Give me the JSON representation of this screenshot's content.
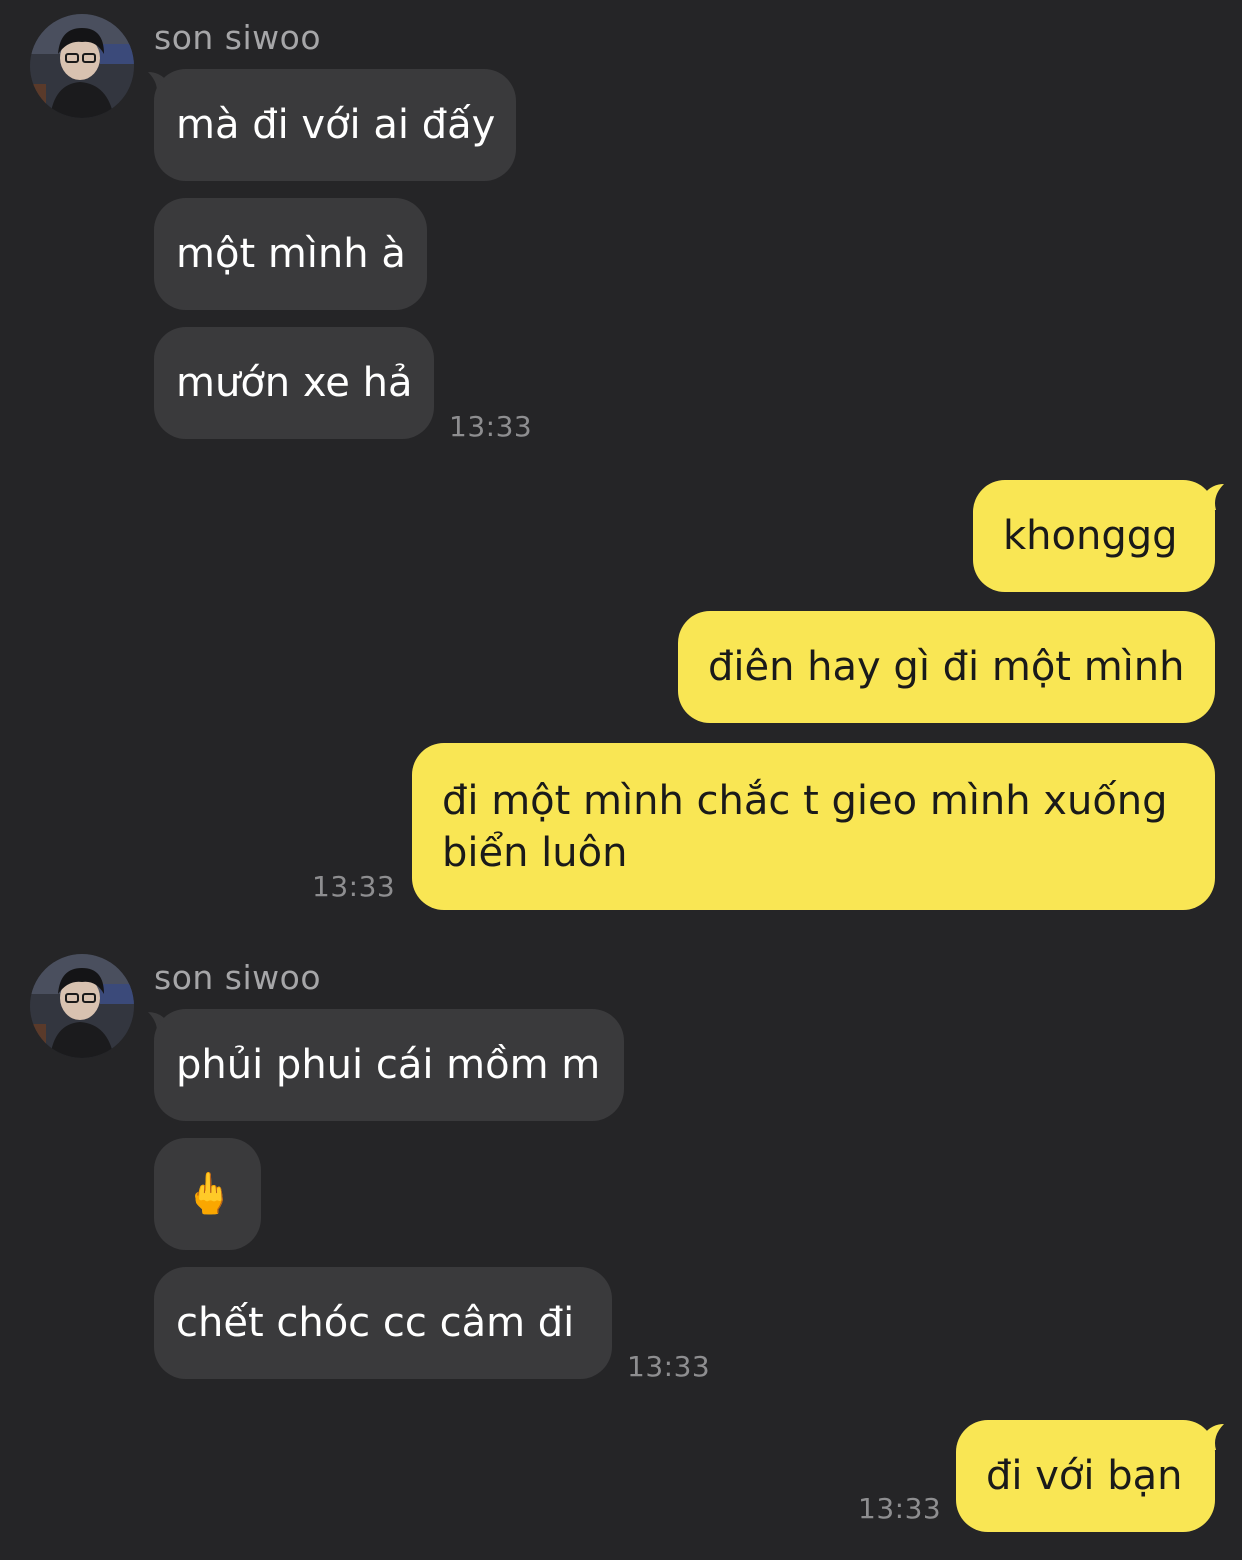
{
  "contact": {
    "name": "son siwoo"
  },
  "groups": [
    {
      "sender": "son siwoo",
      "messages": [
        "mà đi với ai đấy",
        "một mình à",
        "mướn xe hả"
      ],
      "time": "13:33"
    },
    {
      "sender": "me",
      "messages": [
        "khonggg",
        "điên hay gì đi một mình",
        "đi một mình chắc t gieo mình xuống biển luôn"
      ],
      "time": "13:33"
    },
    {
      "sender": "son siwoo",
      "messages": [
        "phủi phui cái mồm m",
        "🖕",
        "chết chóc cc câm đi"
      ],
      "time": "13:33"
    },
    {
      "sender": "me",
      "messages": [
        "đi với bạn"
      ],
      "time": "13:33"
    }
  ],
  "colors": {
    "background": "#252527",
    "incoming_bubble": "#3a3a3c",
    "outgoing_bubble": "#f9e654",
    "incoming_text": "#ffffff",
    "outgoing_text": "#1a1a1a",
    "timestamp": "#8e8e90",
    "sender_name": "#a6a6a8"
  }
}
